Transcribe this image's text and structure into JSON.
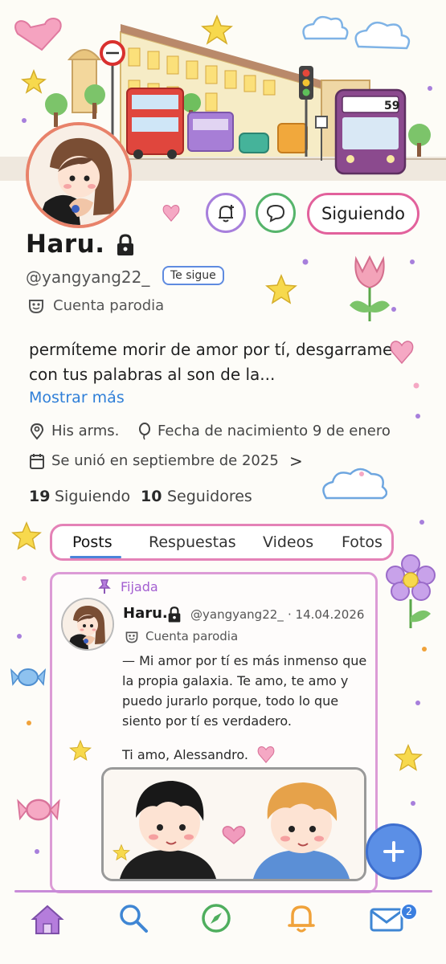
{
  "header": {
    "follow_button_label": "Siguiendo"
  },
  "profile": {
    "display_name": "Haru.",
    "handle": "@yangyang22_",
    "follows_you_badge": "Te sigue",
    "parody_label": "Cuenta parodia",
    "bio": "permíteme morir de amor por tí, desgarrame con tus palabras al son de la...",
    "show_more": "Mostrar más",
    "location": "His arms.",
    "birthday": "Fecha de nacimiento 9 de enero",
    "joined": "Se unió en septiembre de 2025",
    "joined_chevron": ">",
    "following_count": "19",
    "following_label": "Siguiendo",
    "followers_count": "10",
    "followers_label": "Seguidores"
  },
  "tabs": [
    {
      "label": "Posts",
      "selected": true
    },
    {
      "label": "Respuestas",
      "selected": false
    },
    {
      "label": "Videos",
      "selected": false
    },
    {
      "label": "Fotos",
      "selected": false
    }
  ],
  "post": {
    "pinned_label": "Fijada",
    "author_name": "Haru.",
    "author_handle": "@yangyang22_",
    "date": "· 14.04.2026",
    "parody_label": "Cuenta parodia",
    "text": "— Mi amor por tí es más inmenso que la propia galaxia. Te amo, te amo y puedo jurarlo porque, todo lo que siento por tí es verdadero.",
    "signature": "Ti amo, Alessandro."
  },
  "banner": {
    "bus_number": "59"
  },
  "bottom_nav": {
    "items": [
      "home-icon",
      "search-icon",
      "explore-icon",
      "notifications-icon",
      "messages-icon"
    ],
    "messages_badge": "2"
  },
  "colors": {
    "accent_blue": "#2f7fd8",
    "pink_border": "#e482b7",
    "purple": "#a35fd1",
    "fab_blue": "#5b8fe6"
  }
}
